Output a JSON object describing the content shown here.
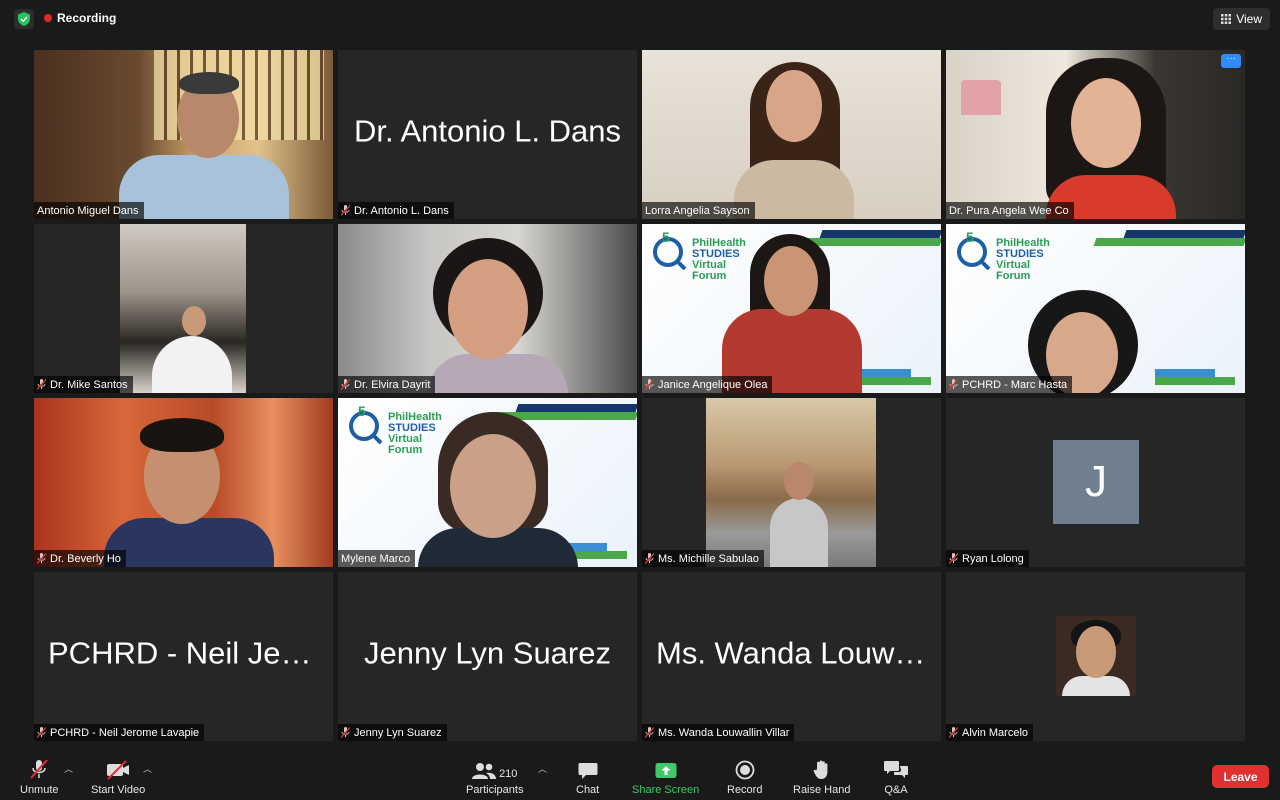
{
  "topbar": {
    "recording_label": "Recording",
    "view_label": "View"
  },
  "tiles": [
    {
      "name": "Antonio Miguel Dans",
      "muted": false
    },
    {
      "name": "Dr. Antonio L. Dans",
      "display_name": "Dr. Antonio L. Dans",
      "muted": true
    },
    {
      "name": "Lorra Angelia Sayson",
      "muted": false
    },
    {
      "name": "Dr. Pura Angela Wee Co",
      "muted": false
    },
    {
      "name": "Dr. Mike Santos",
      "muted": true
    },
    {
      "name": "Dr. Elvira Dayrit",
      "muted": true
    },
    {
      "name": "Janice Angelique Olea",
      "muted": true
    },
    {
      "name": "PCHRD - Marc Hasta",
      "muted": true
    },
    {
      "name": "Dr. Beverly Ho",
      "muted": true
    },
    {
      "name": "Mylene Marco",
      "muted": false,
      "active_speaker": true
    },
    {
      "name": "Ms. Michille Sabulao",
      "muted": true
    },
    {
      "name": "Ryan Lolong",
      "muted": true,
      "avatar_letter": "J"
    },
    {
      "name": "PCHRD - Neil Jerome Lavapie",
      "display_name": "PCHRD - Neil Jero...",
      "muted": true
    },
    {
      "name": "Jenny Lyn Suarez",
      "display_name": "Jenny Lyn Suarez",
      "muted": true
    },
    {
      "name": "Ms. Wanda Louwallin Villar",
      "display_name": "Ms. Wanda Louwalli...",
      "muted": true
    },
    {
      "name": "Alvin Marcelo",
      "muted": true
    }
  ],
  "banner": {
    "line1": "PhilHealth",
    "line2": "STUDIES",
    "line3": "Virtual Forum"
  },
  "toolbar": {
    "unmute": "Unmute",
    "start_video": "Start Video",
    "participants": "Participants",
    "participants_count": "210",
    "chat": "Chat",
    "share_screen": "Share Screen",
    "record": "Record",
    "raise_hand": "Raise Hand",
    "qa": "Q&A",
    "leave": "Leave"
  },
  "colors": {
    "active_speaker_border": "#cfe36a",
    "share_screen_green": "#3ec96b",
    "leave_red": "#e03030",
    "recording_red": "#e02828"
  }
}
